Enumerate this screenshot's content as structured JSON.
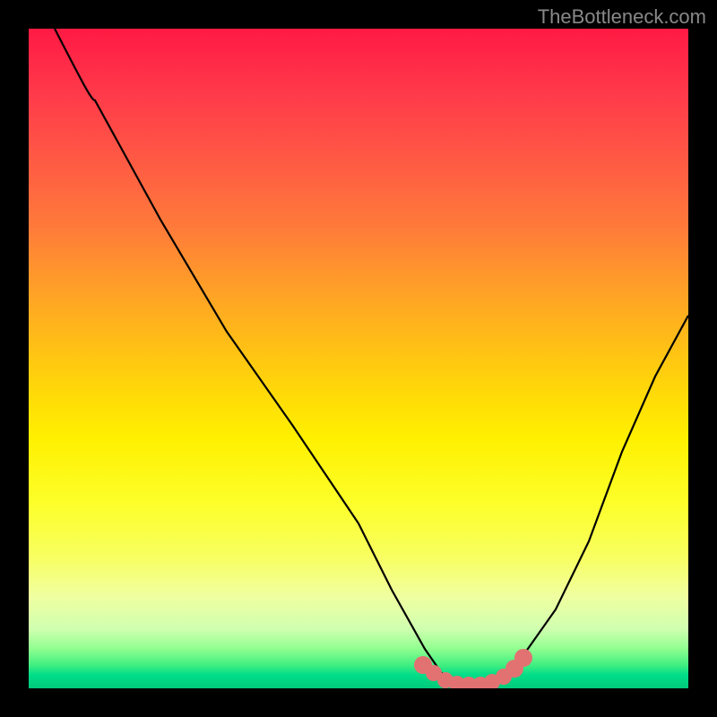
{
  "watermark": "TheBottleneck.com",
  "chart_data": {
    "type": "line",
    "title": "",
    "xlabel": "",
    "ylabel": "",
    "xlim": [
      0,
      100
    ],
    "ylim": [
      0,
      100
    ],
    "background": "vertical-gradient-red-to-green",
    "series": [
      {
        "name": "bottleneck-curve",
        "x": [
          4,
          10,
          20,
          30,
          40,
          50,
          55,
          60,
          65,
          68,
          70,
          75,
          80,
          85,
          90,
          95,
          100
        ],
        "values": [
          100,
          89,
          72,
          55,
          40,
          25,
          15,
          6,
          1,
          0,
          0,
          1,
          5,
          12,
          22,
          34,
          48
        ]
      }
    ],
    "markers": [
      {
        "name": "optimal-range-marker",
        "x_center": 65,
        "y": 0.5,
        "color": "#e27272"
      }
    ],
    "colors": {
      "curve": "#000000",
      "marker": "#e27272",
      "frame": "#000000"
    }
  }
}
